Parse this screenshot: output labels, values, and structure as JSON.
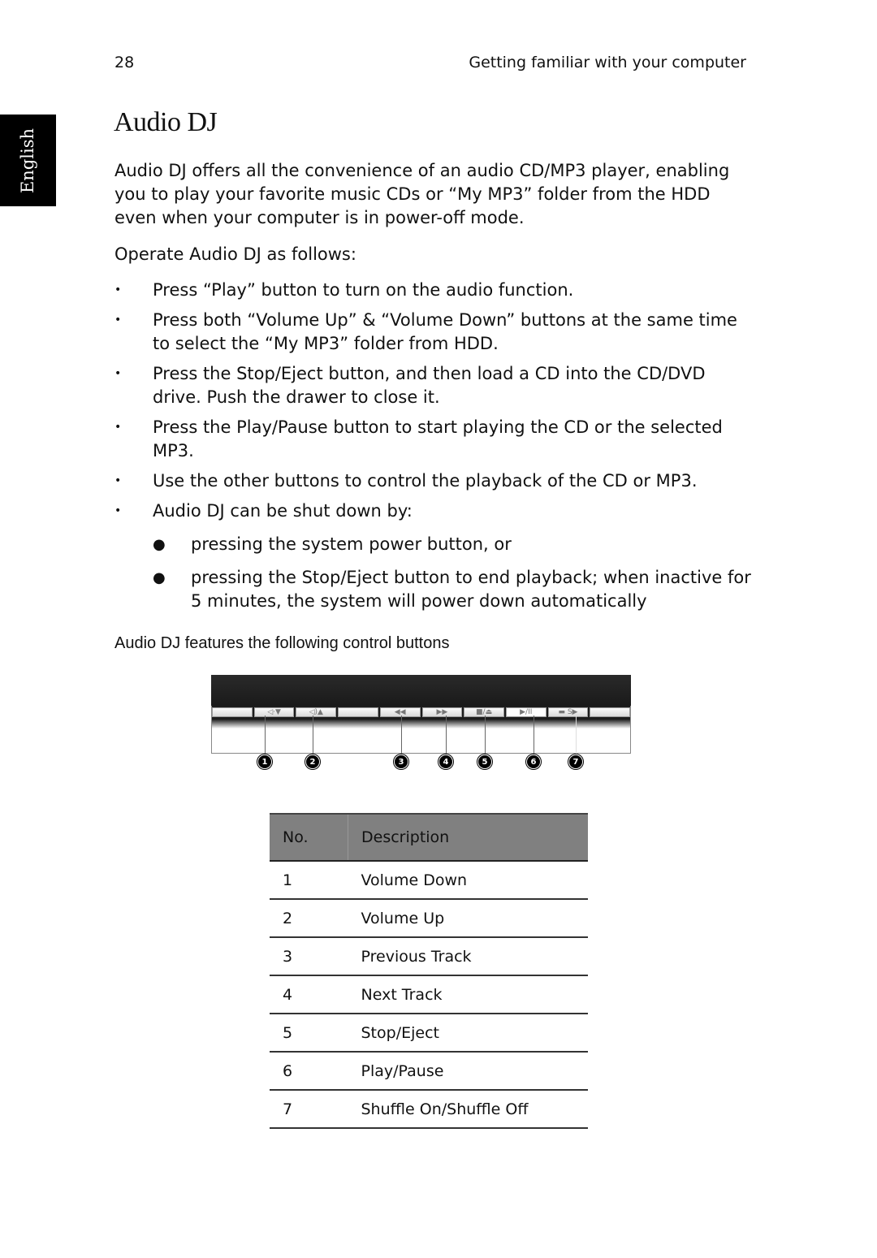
{
  "header": {
    "page_number": "28",
    "chapter": "Getting familiar with your computer"
  },
  "language_tab": "English",
  "title": "Audio DJ",
  "intro": "Audio DJ offers all the convenience of an audio CD/MP3 player, enabling you to play your favorite music CDs or “My MP3” folder from the HDD even when your computer is in power-off mode.",
  "lead": "Operate Audio DJ as follows:",
  "bullets": [
    "Press “Play” button to turn on the audio function.",
    "Press both “Volume Up” & “Volume Down” buttons at the same time to select the “My MP3” folder from HDD.",
    "Press the Stop/Eject button, and then load a CD into the CD/DVD drive. Push the drawer to close it.",
    "Press the Play/Pause button to start playing the CD or the selected MP3.",
    "Use the other buttons to control the playback of the CD or MP3.",
    "Audio DJ can be shut down by:"
  ],
  "sub_bullets": [
    "pressing the system power button, or",
    "pressing the Stop/Eject button to end playback; when inactive for 5 minutes, the system will power down automatically"
  ],
  "caption": "Audio DJ features the following control buttons",
  "panel": {
    "buttons": [
      {
        "icon": "",
        "name": "blank"
      },
      {
        "icon": "◁·▼",
        "name": "volume-down"
      },
      {
        "icon": "◁)▲",
        "name": "volume-up"
      },
      {
        "icon": "",
        "name": "blank"
      },
      {
        "icon": "◀◀",
        "name": "previous-track"
      },
      {
        "icon": "▶▶",
        "name": "next-track"
      },
      {
        "icon": "■/⏏",
        "name": "stop-eject"
      },
      {
        "icon": "▶/II",
        "name": "play-pause"
      },
      {
        "icon": "▬ S▶",
        "name": "shuffle"
      },
      {
        "icon": "",
        "name": "blank"
      }
    ],
    "callouts": [
      "1",
      "2",
      "3",
      "4",
      "5",
      "6",
      "7"
    ]
  },
  "table": {
    "headers": [
      "No.",
      "Description"
    ],
    "rows": [
      [
        "1",
        "Volume Down"
      ],
      [
        "2",
        "Volume Up"
      ],
      [
        "3",
        "Previous Track"
      ],
      [
        "4",
        "Next Track"
      ],
      [
        "5",
        "Stop/Eject"
      ],
      [
        "6",
        "Play/Pause"
      ],
      [
        "7",
        "Shuffle On/Shuffle Off"
      ]
    ]
  }
}
